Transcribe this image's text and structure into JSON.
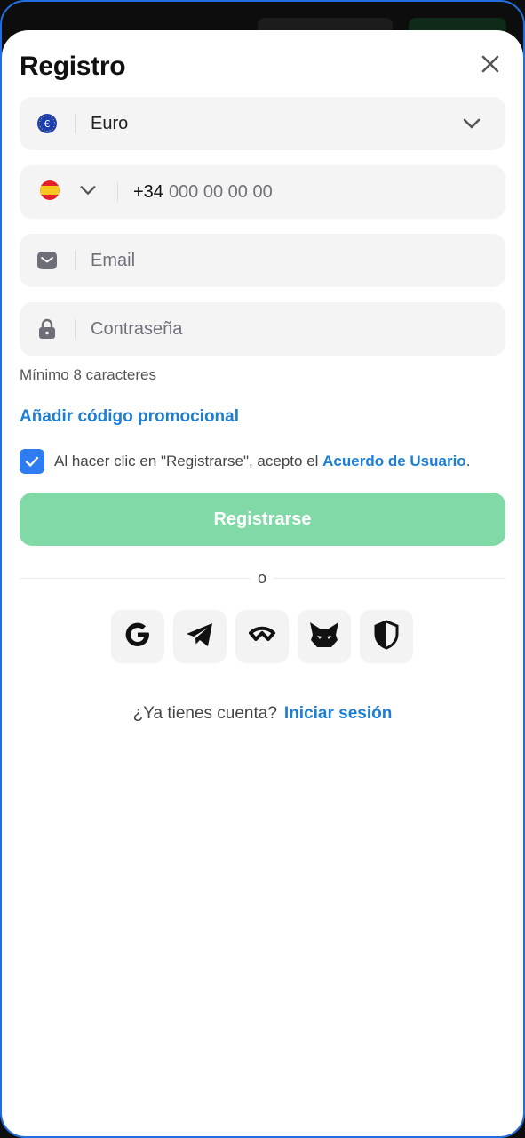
{
  "modal": {
    "title": "Registro"
  },
  "currency": {
    "icon": "euro-coin-icon",
    "value": "Euro"
  },
  "phone": {
    "flag": "spain-flag-icon",
    "prefix": "+34",
    "placeholder": "000 00 00 00"
  },
  "email": {
    "placeholder": "Email"
  },
  "password": {
    "placeholder": "Contraseña",
    "hint": "Mínimo 8 caracteres"
  },
  "promo": {
    "label": "Añadir código promocional"
  },
  "agreement": {
    "checked": true,
    "text": "Al hacer clic en \"Registrarse\", acepto el ",
    "link": "Acuerdo de Usuario",
    "suffix": "."
  },
  "register": {
    "label": "Registrarse",
    "color": "#80d9a6"
  },
  "divider": {
    "label": "o"
  },
  "social_logins": [
    {
      "icon": "google-icon"
    },
    {
      "icon": "telegram-icon"
    },
    {
      "icon": "walletconnect-icon"
    },
    {
      "icon": "metamask-icon"
    },
    {
      "icon": "shield-icon"
    }
  ],
  "login": {
    "question": "¿Ya tienes cuenta?",
    "link": "Iniciar sesión"
  },
  "colors": {
    "accent": "#1d7fd4",
    "checkbox": "#2f7cf0",
    "field_bg": "#f4f4f5"
  }
}
